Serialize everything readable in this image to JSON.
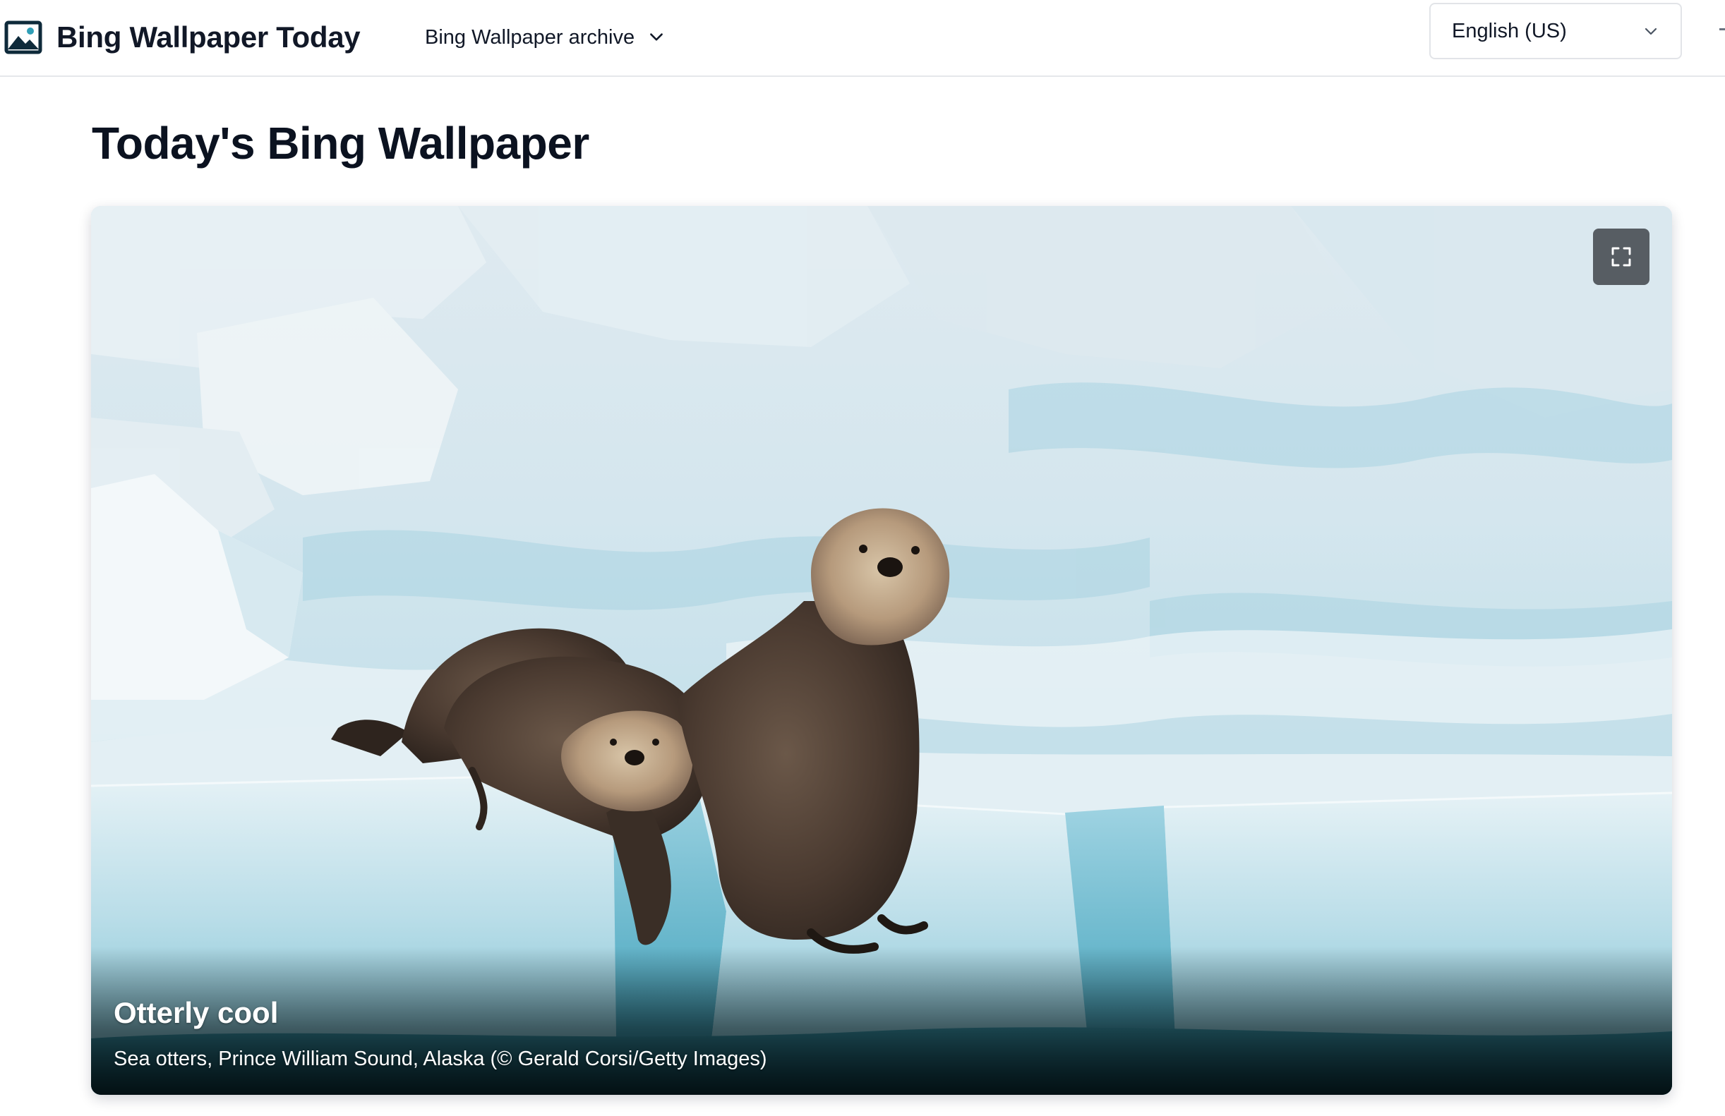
{
  "header": {
    "brand_name": "Bing Wallpaper Today",
    "brand_icon": "image-icon",
    "archive_menu_label": "Bing Wallpaper archive",
    "language_selected": "English (US)"
  },
  "main": {
    "page_title": "Today's Bing Wallpaper",
    "wallpaper": {
      "title": "Otterly cool",
      "description": "Sea otters, Prince William Sound, Alaska (© Gerald Corsi/Getty Images)",
      "fullscreen_icon": "expand-icon"
    }
  },
  "colors": {
    "ice_light": "#e8f1f5",
    "ice_blue": "#9fd0e0",
    "water_teal": "#1f7f95",
    "otter_brown": "#4a3a30"
  }
}
